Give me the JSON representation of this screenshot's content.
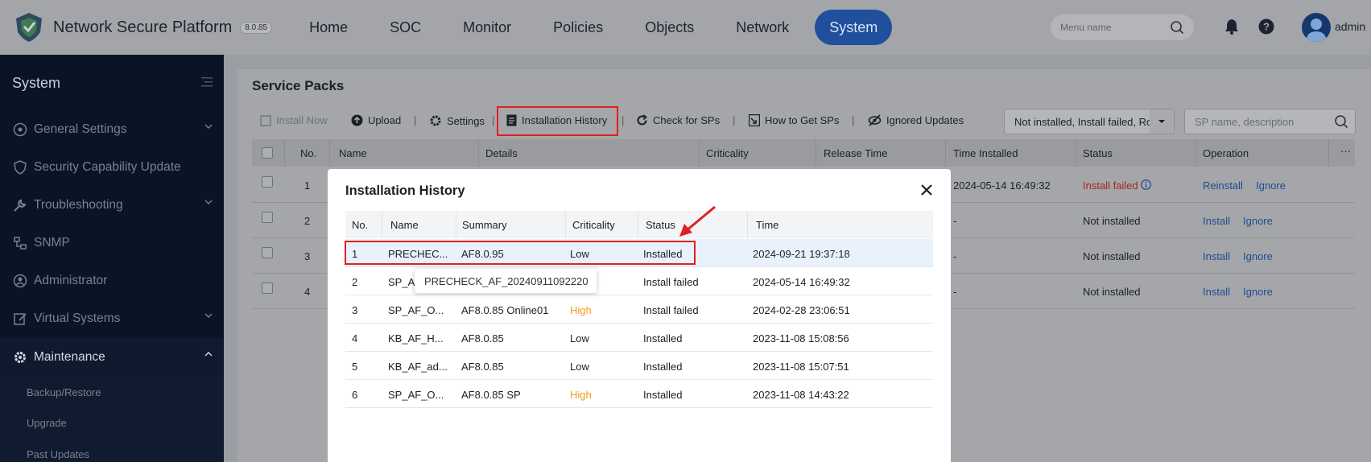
{
  "header": {
    "brand": "Network Secure Platform",
    "version": "8.0.85",
    "nav": [
      "Home",
      "SOC",
      "Monitor",
      "Policies",
      "Objects",
      "Network",
      "System"
    ],
    "active_nav": "System",
    "menu_search_placeholder": "Menu name",
    "user": "admin"
  },
  "sidebar": {
    "title": "System",
    "items": [
      {
        "label": "General Settings"
      },
      {
        "label": "Security Capability Update"
      },
      {
        "label": "Troubleshooting"
      },
      {
        "label": "SNMP"
      },
      {
        "label": "Administrator"
      },
      {
        "label": "Virtual Systems"
      },
      {
        "label": "Maintenance"
      }
    ],
    "subitems": [
      "Backup/Restore",
      "Upgrade",
      "Past Updates"
    ]
  },
  "page": {
    "title": "Service Packs",
    "toolbar": {
      "install_now": "Install Now",
      "upload": "Upload",
      "settings": "Settings",
      "installation_history": "Installation History",
      "check_for_sps": "Check for SPs",
      "how_to_get_sps": "How to Get SPs",
      "ignored_updates": "Ignored Updates",
      "separator": "|"
    },
    "filter_value": "Not installed, Install failed, Ro",
    "search_placeholder": "SP name, description",
    "columns": [
      "No.",
      "Name",
      "Details",
      "Criticality",
      "Release Time",
      "Time Installed",
      "Status",
      "Operation",
      "···"
    ],
    "rows": [
      {
        "no": "1",
        "time_installed": "2024-05-14 16:49:32",
        "status": "Install failed",
        "ops": [
          "Reinstall",
          "Ignore"
        ]
      },
      {
        "no": "2",
        "time_installed": "-",
        "status": "Not installed",
        "ops": [
          "Install",
          "Ignore"
        ]
      },
      {
        "no": "3",
        "time_installed": "-",
        "status": "Not installed",
        "ops": [
          "Install",
          "Ignore"
        ]
      },
      {
        "no": "4",
        "time_installed": "-",
        "status": "Not installed",
        "ops": [
          "Install",
          "Ignore"
        ]
      }
    ]
  },
  "modal": {
    "title": "Installation History",
    "columns": [
      "No.",
      "Name",
      "Summary",
      "Criticality",
      "Status",
      "Time"
    ],
    "rows": [
      {
        "no": "1",
        "name": "PRECHEC...",
        "summary": "AF8.0.95",
        "criticality": "Low",
        "status": "Installed",
        "time": "2024-09-21 19:37:18"
      },
      {
        "no": "2",
        "name": "SP_A",
        "summary": "",
        "criticality": "",
        "status": "Install failed",
        "time": "2024-05-14 16:49:32"
      },
      {
        "no": "3",
        "name": "SP_AF_O...",
        "summary": "AF8.0.85 Online01",
        "criticality": "High",
        "status": "Install failed",
        "time": "2024-02-28 23:06:51"
      },
      {
        "no": "4",
        "name": "KB_AF_H...",
        "summary": "AF8.0.85",
        "criticality": "Low",
        "status": "Installed",
        "time": "2023-11-08 15:08:56"
      },
      {
        "no": "5",
        "name": "KB_AF_ad...",
        "summary": "AF8.0.85",
        "criticality": "Low",
        "status": "Installed",
        "time": "2023-11-08 15:07:51"
      },
      {
        "no": "6",
        "name": "SP_AF_O...",
        "summary": "AF8.0.85 SP",
        "criticality": "High",
        "status": "Installed",
        "time": "2023-11-08 14:43:22"
      }
    ],
    "tooltip": "PRECHECK_AF_20240911092220"
  },
  "colors": {
    "nav_active": "#1f4f9d",
    "highlight": "#e02020",
    "high_criticality": "#f39a1b",
    "link": "#1f4b93",
    "failed": "#a92222"
  },
  "icons": [
    "shield-logo-icon",
    "search-icon",
    "bell-icon",
    "help-icon",
    "avatar-icon",
    "gear-icon",
    "chevron-down-icon",
    "close-icon",
    "upload-icon",
    "refresh-icon",
    "document-icon",
    "eye-off-icon",
    "info-icon"
  ]
}
